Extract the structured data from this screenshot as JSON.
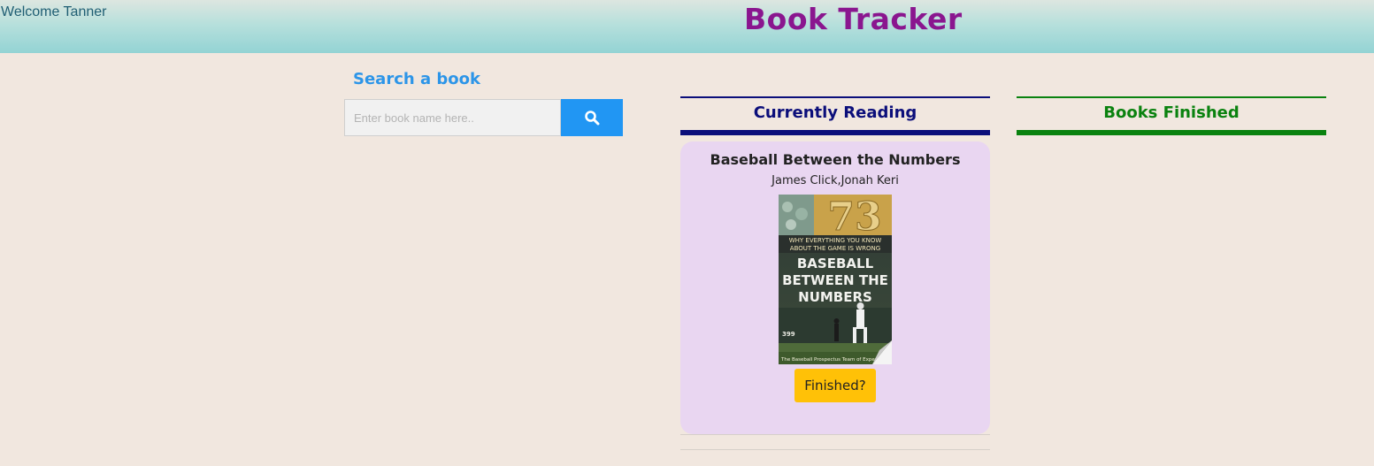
{
  "header": {
    "welcome": "Welcome Tanner",
    "title": "Book Tracker"
  },
  "search": {
    "heading": "Search a book",
    "placeholder": "Enter book name here..",
    "value": "",
    "button_icon": "search-icon"
  },
  "columns": {
    "reading": "Currently Reading",
    "finished": "Books Finished"
  },
  "reading_list": [
    {
      "title": "Baseball Between the Numbers",
      "authors": "James Click,Jonah Keri",
      "cover": {
        "number": "73",
        "tagline_1": "WHY EVERYTHING YOU KNOW",
        "tagline_2": "ABOUT THE GAME IS WRONG",
        "title_lines": [
          "BASEBALL",
          "BETWEEN THE",
          "NUMBERS"
        ],
        "distance": "399",
        "publisher": "The Baseball Prospectus Team of Experts"
      },
      "action_label": "Finished?"
    }
  ],
  "colors": {
    "title": "#8a168f",
    "search_heading": "#2c95e8",
    "search_button": "#2196f3",
    "reading_accent": "#0b0e7a",
    "finished_accent": "#0a820f",
    "card_bg": "#e9d6f1",
    "finished_button": "#ffc107"
  }
}
